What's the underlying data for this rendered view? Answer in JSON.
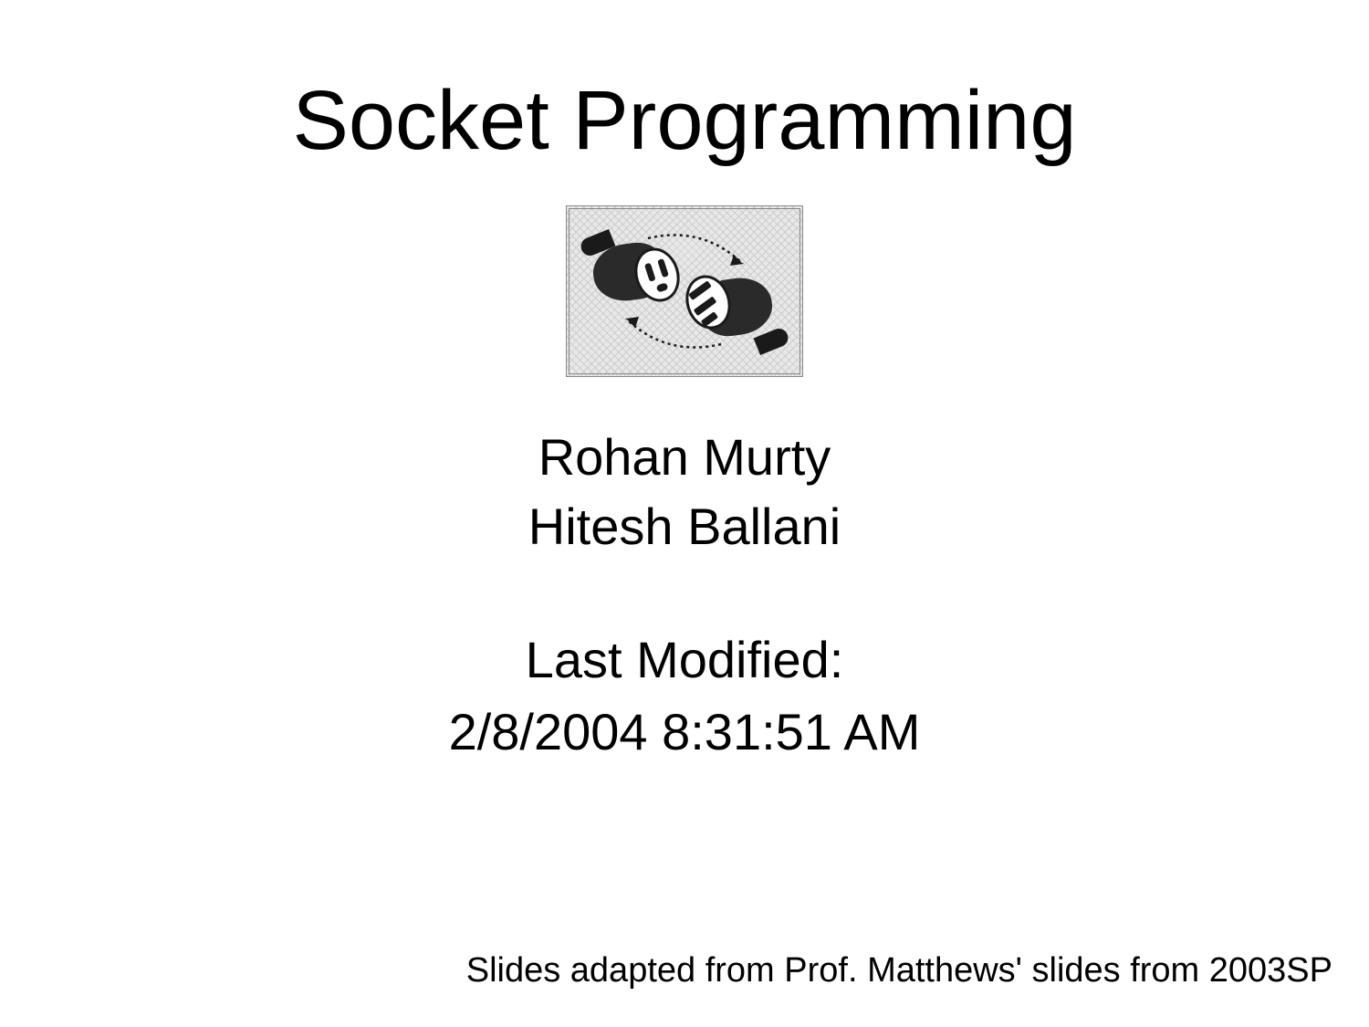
{
  "title": "Socket Programming",
  "authors": {
    "line1": "Rohan Murty",
    "line2": "Hitesh Ballani"
  },
  "modified": {
    "label": "Last Modified:",
    "datetime": "2/8/2004 8:31:51 AM"
  },
  "footer": "Slides adapted from Prof. Matthews' slides from 2003SP",
  "image_alt": "socket-plug-illustration"
}
